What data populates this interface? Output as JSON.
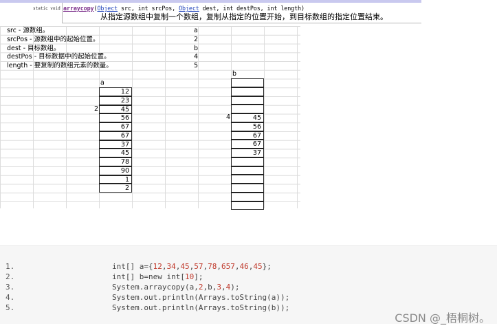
{
  "header": {
    "modifiers": "static void",
    "method_name": "arraycopy",
    "signature_parts": [
      "(",
      "Object",
      " src, int srcPos, ",
      "Object",
      " dest, int destPos, int length)"
    ],
    "description": "从指定源数组中复制一个数组，复制从指定的位置开始，到目标数组的指定位置结束。"
  },
  "params": [
    {
      "label": "src - 源数组。",
      "value": "a"
    },
    {
      "label": "srcPos - 源数组中的起始位置。",
      "value": "2"
    },
    {
      "label": "dest - 目标数组。",
      "value": "b"
    },
    {
      "label": "destPos - 目标数据中的起始位置。",
      "value": "4"
    },
    {
      "label": "length - 要复制的数组元素的数量。",
      "value": "5"
    }
  ],
  "array_a": {
    "label": "a",
    "index_marker": "2",
    "values": [
      "12",
      "23",
      "45",
      "56",
      "67",
      "67",
      "37",
      "45",
      "78",
      "90",
      "1",
      "2"
    ]
  },
  "array_b": {
    "label": "b",
    "index_marker": "4",
    "values": [
      "",
      "",
      "",
      "",
      "45",
      "56",
      "67",
      "67",
      "37",
      "",
      "",
      "",
      "",
      "",
      ""
    ]
  },
  "code": {
    "lines": [
      {
        "no": "1.",
        "text": "int[] a={12,34,45,57,78,657,46,45};"
      },
      {
        "no": "2.",
        "text": "int[] b=new int[10];"
      },
      {
        "no": "3.",
        "text": "System.arraycopy(a,2,b,3,4);"
      },
      {
        "no": "4.",
        "text": "System.out.println(Arrays.toString(a));"
      },
      {
        "no": "5.",
        "text": "System.out.println(Arrays.toString(b));"
      }
    ]
  },
  "watermark": "CSDN @_梧桐树。"
}
